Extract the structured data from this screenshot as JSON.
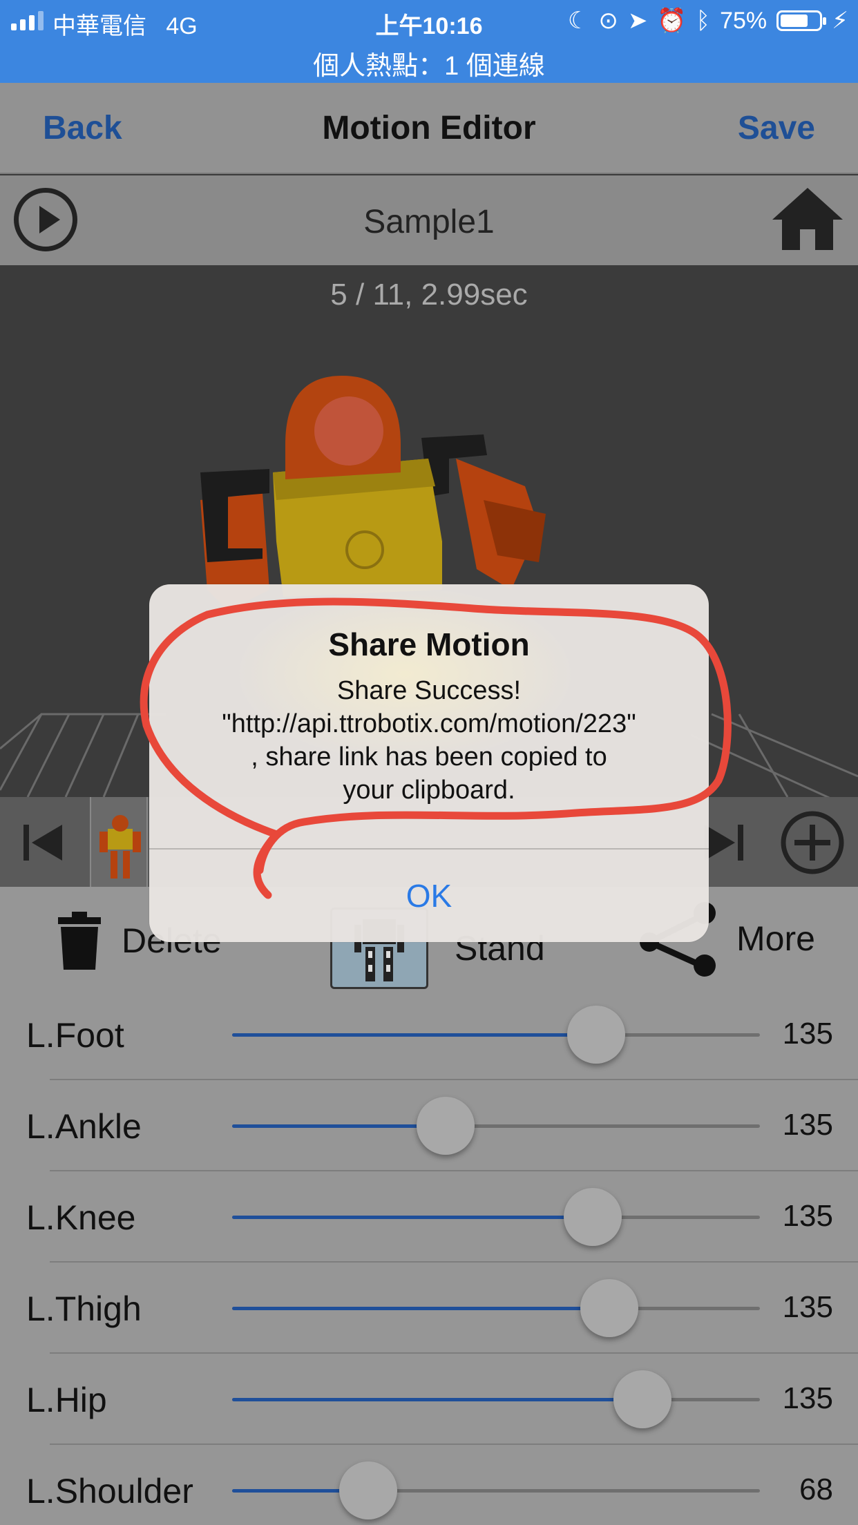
{
  "status_bar": {
    "carrier": "中華電信",
    "network": "4G",
    "time": "上午10:16",
    "battery": "75%",
    "battery_level": 0.75,
    "hotspot": "個人熱點：1 個連線"
  },
  "nav": {
    "back_label": "Back",
    "title": "Motion Editor",
    "save_label": "Save"
  },
  "motion": {
    "name": "Sample1",
    "frame_info": "5 / 11, 2.99sec"
  },
  "toolbar": {
    "delete_label": "Delete",
    "stand_label": "Stand",
    "more_label": "More"
  },
  "sliders": [
    {
      "label": "L.Foot",
      "value": "135",
      "level": 0.69
    },
    {
      "label": "L.Ankle",
      "value": "135",
      "level": 0.405
    },
    {
      "label": "L.Knee",
      "value": "135",
      "level": 0.683
    },
    {
      "label": "L.Thigh",
      "value": "135",
      "level": 0.715
    },
    {
      "label": "L.Hip",
      "value": "135",
      "level": 0.777
    },
    {
      "label": "L.Shoulder",
      "value": "68",
      "level": 0.258
    }
  ],
  "alert": {
    "title": "Share Motion",
    "message_lines": [
      "Share Success!",
      "\"http://api.ttrobotix.com/motion/223\"",
      ", share link has been copied to",
      "your clipboard."
    ],
    "ok_label": "OK"
  },
  "colors": {
    "status_bar": "#3c86e0",
    "nav_link": "#1e4f96",
    "slider_fill": "#1f4f9a",
    "alert_button": "#2a7ae6",
    "annotation": "#e8483a"
  }
}
